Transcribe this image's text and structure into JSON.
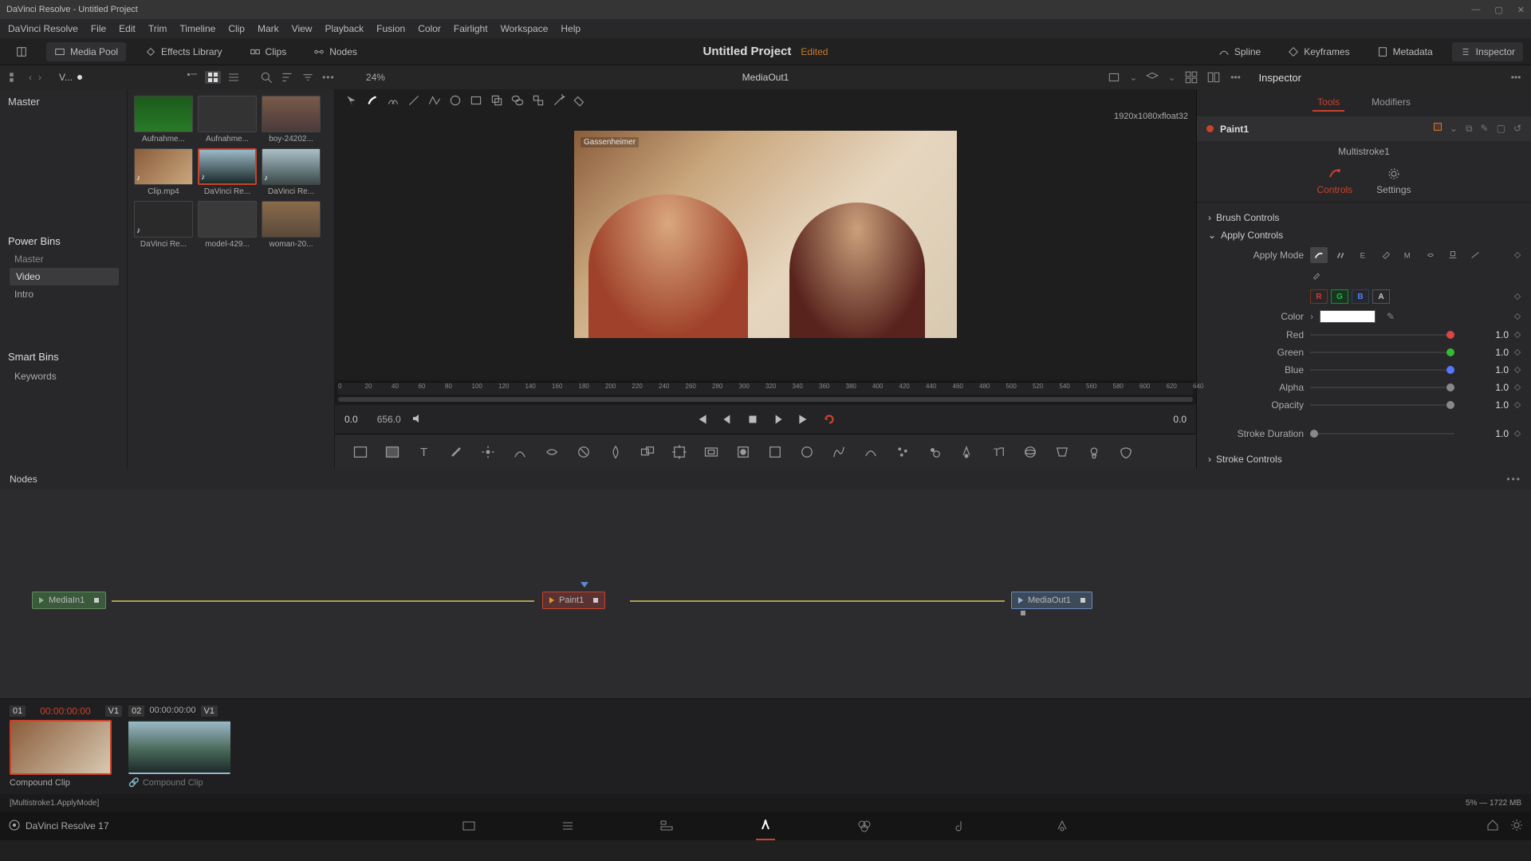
{
  "app": {
    "title": "DaVinci Resolve - Untitled Project"
  },
  "menu": [
    "DaVinci Resolve",
    "File",
    "Edit",
    "Trim",
    "Timeline",
    "Clip",
    "Mark",
    "View",
    "Playback",
    "Fusion",
    "Color",
    "Fairlight",
    "Workspace",
    "Help"
  ],
  "toolbar": {
    "media_pool": "Media Pool",
    "effects": "Effects Library",
    "clips": "Clips",
    "nodes": "Nodes",
    "spline": "Spline",
    "keyframes": "Keyframes",
    "metadata": "Metadata",
    "inspector": "Inspector"
  },
  "project": {
    "name": "Untitled Project",
    "edited": "Edited"
  },
  "subbar": {
    "vlabel": "V...",
    "zoom": "24%",
    "viewer_title": "MediaOut1",
    "inspector_label": "Inspector"
  },
  "bins": {
    "master": "Master",
    "power_bins": "Power Bins",
    "master_sub": "Master",
    "video": "Video",
    "intro": "Intro",
    "smart": "Smart Bins",
    "keywords": "Keywords"
  },
  "thumbs": [
    {
      "label": "Aufnahme..."
    },
    {
      "label": "Aufnahme..."
    },
    {
      "label": "boy-24202..."
    },
    {
      "label": "Clip.mp4"
    },
    {
      "label": "DaVinci Re...",
      "sel": true
    },
    {
      "label": "DaVinci Re..."
    },
    {
      "label": "DaVinci Re..."
    },
    {
      "label": "model-429..."
    },
    {
      "label": "woman-20..."
    }
  ],
  "viewer": {
    "tag": "Gassenheimer",
    "info": "1920x1080xfloat32",
    "tc_in": "0.0",
    "tc_dur": "656.0",
    "tc_out": "0.0",
    "ticks": [
      "0",
      "20",
      "40",
      "60",
      "80",
      "100",
      "120",
      "140",
      "160",
      "180",
      "200",
      "220",
      "240",
      "260",
      "280",
      "300",
      "320",
      "340",
      "360",
      "380",
      "400",
      "420",
      "440",
      "460",
      "480",
      "500",
      "520",
      "540",
      "560",
      "580",
      "600",
      "620",
      "640"
    ]
  },
  "nodes": {
    "title": "Nodes",
    "n1": "MediaIn1",
    "n2": "Paint1",
    "n3": "MediaOut1"
  },
  "inspector": {
    "tools": "Tools",
    "modifiers": "Modifiers",
    "node": "Paint1",
    "multistroke": "Multistroke1",
    "controls": "Controls",
    "settings": "Settings",
    "brush": "Brush Controls",
    "apply": "Apply Controls",
    "stroke": "Stroke Controls",
    "applymode": "Apply Mode",
    "ch": {
      "r": "R",
      "g": "G",
      "b": "B",
      "a": "A"
    },
    "color": "Color",
    "red": {
      "l": "Red",
      "v": "1.0"
    },
    "green": {
      "l": "Green",
      "v": "1.0"
    },
    "blue": {
      "l": "Blue",
      "v": "1.0"
    },
    "alpha": {
      "l": "Alpha",
      "v": "1.0"
    },
    "opacity": {
      "l": "Opacity",
      "v": "1.0"
    },
    "duration": {
      "l": "Stroke Duration",
      "v": "1.0"
    }
  },
  "clips": {
    "c1": {
      "num": "01",
      "tc": "00:00:00:00",
      "trk": "V1",
      "label": "Compound Clip"
    },
    "c2": {
      "num": "02",
      "tc": "00:00:00:00",
      "trk": "V1",
      "label": "Compound Clip"
    }
  },
  "status": {
    "left": "[Multistroke1.ApplyMode]",
    "right": "5% — 1722 MB"
  },
  "bottom": {
    "app": "DaVinci Resolve 17"
  }
}
